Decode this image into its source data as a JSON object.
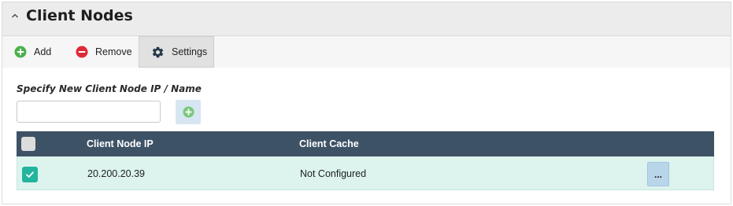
{
  "panel": {
    "title": "Client Nodes"
  },
  "toolbar": {
    "add_label": "Add",
    "remove_label": "Remove",
    "settings_label": "Settings"
  },
  "form": {
    "label": "Specify New Client Node IP / Name",
    "input_value": "",
    "input_placeholder": ""
  },
  "table": {
    "columns": [
      "",
      "Client Node IP",
      "Client Cache"
    ],
    "rows": [
      {
        "selected": true,
        "ip": "20.200.20.39",
        "cache": "Not Configured",
        "action_label": "..."
      }
    ]
  },
  "colors": {
    "header_bg": "#3e5266",
    "row_selected_bg": "#dcf3ee",
    "checkbox_checked": "#22b49c",
    "add_icon": "#4cb04c",
    "remove_icon": "#dd2a36"
  },
  "icons": {
    "collapse": "chevron-up-icon",
    "add": "plus-circle-icon",
    "remove": "minus-circle-icon",
    "settings": "gear-icon",
    "check": "check-icon"
  }
}
